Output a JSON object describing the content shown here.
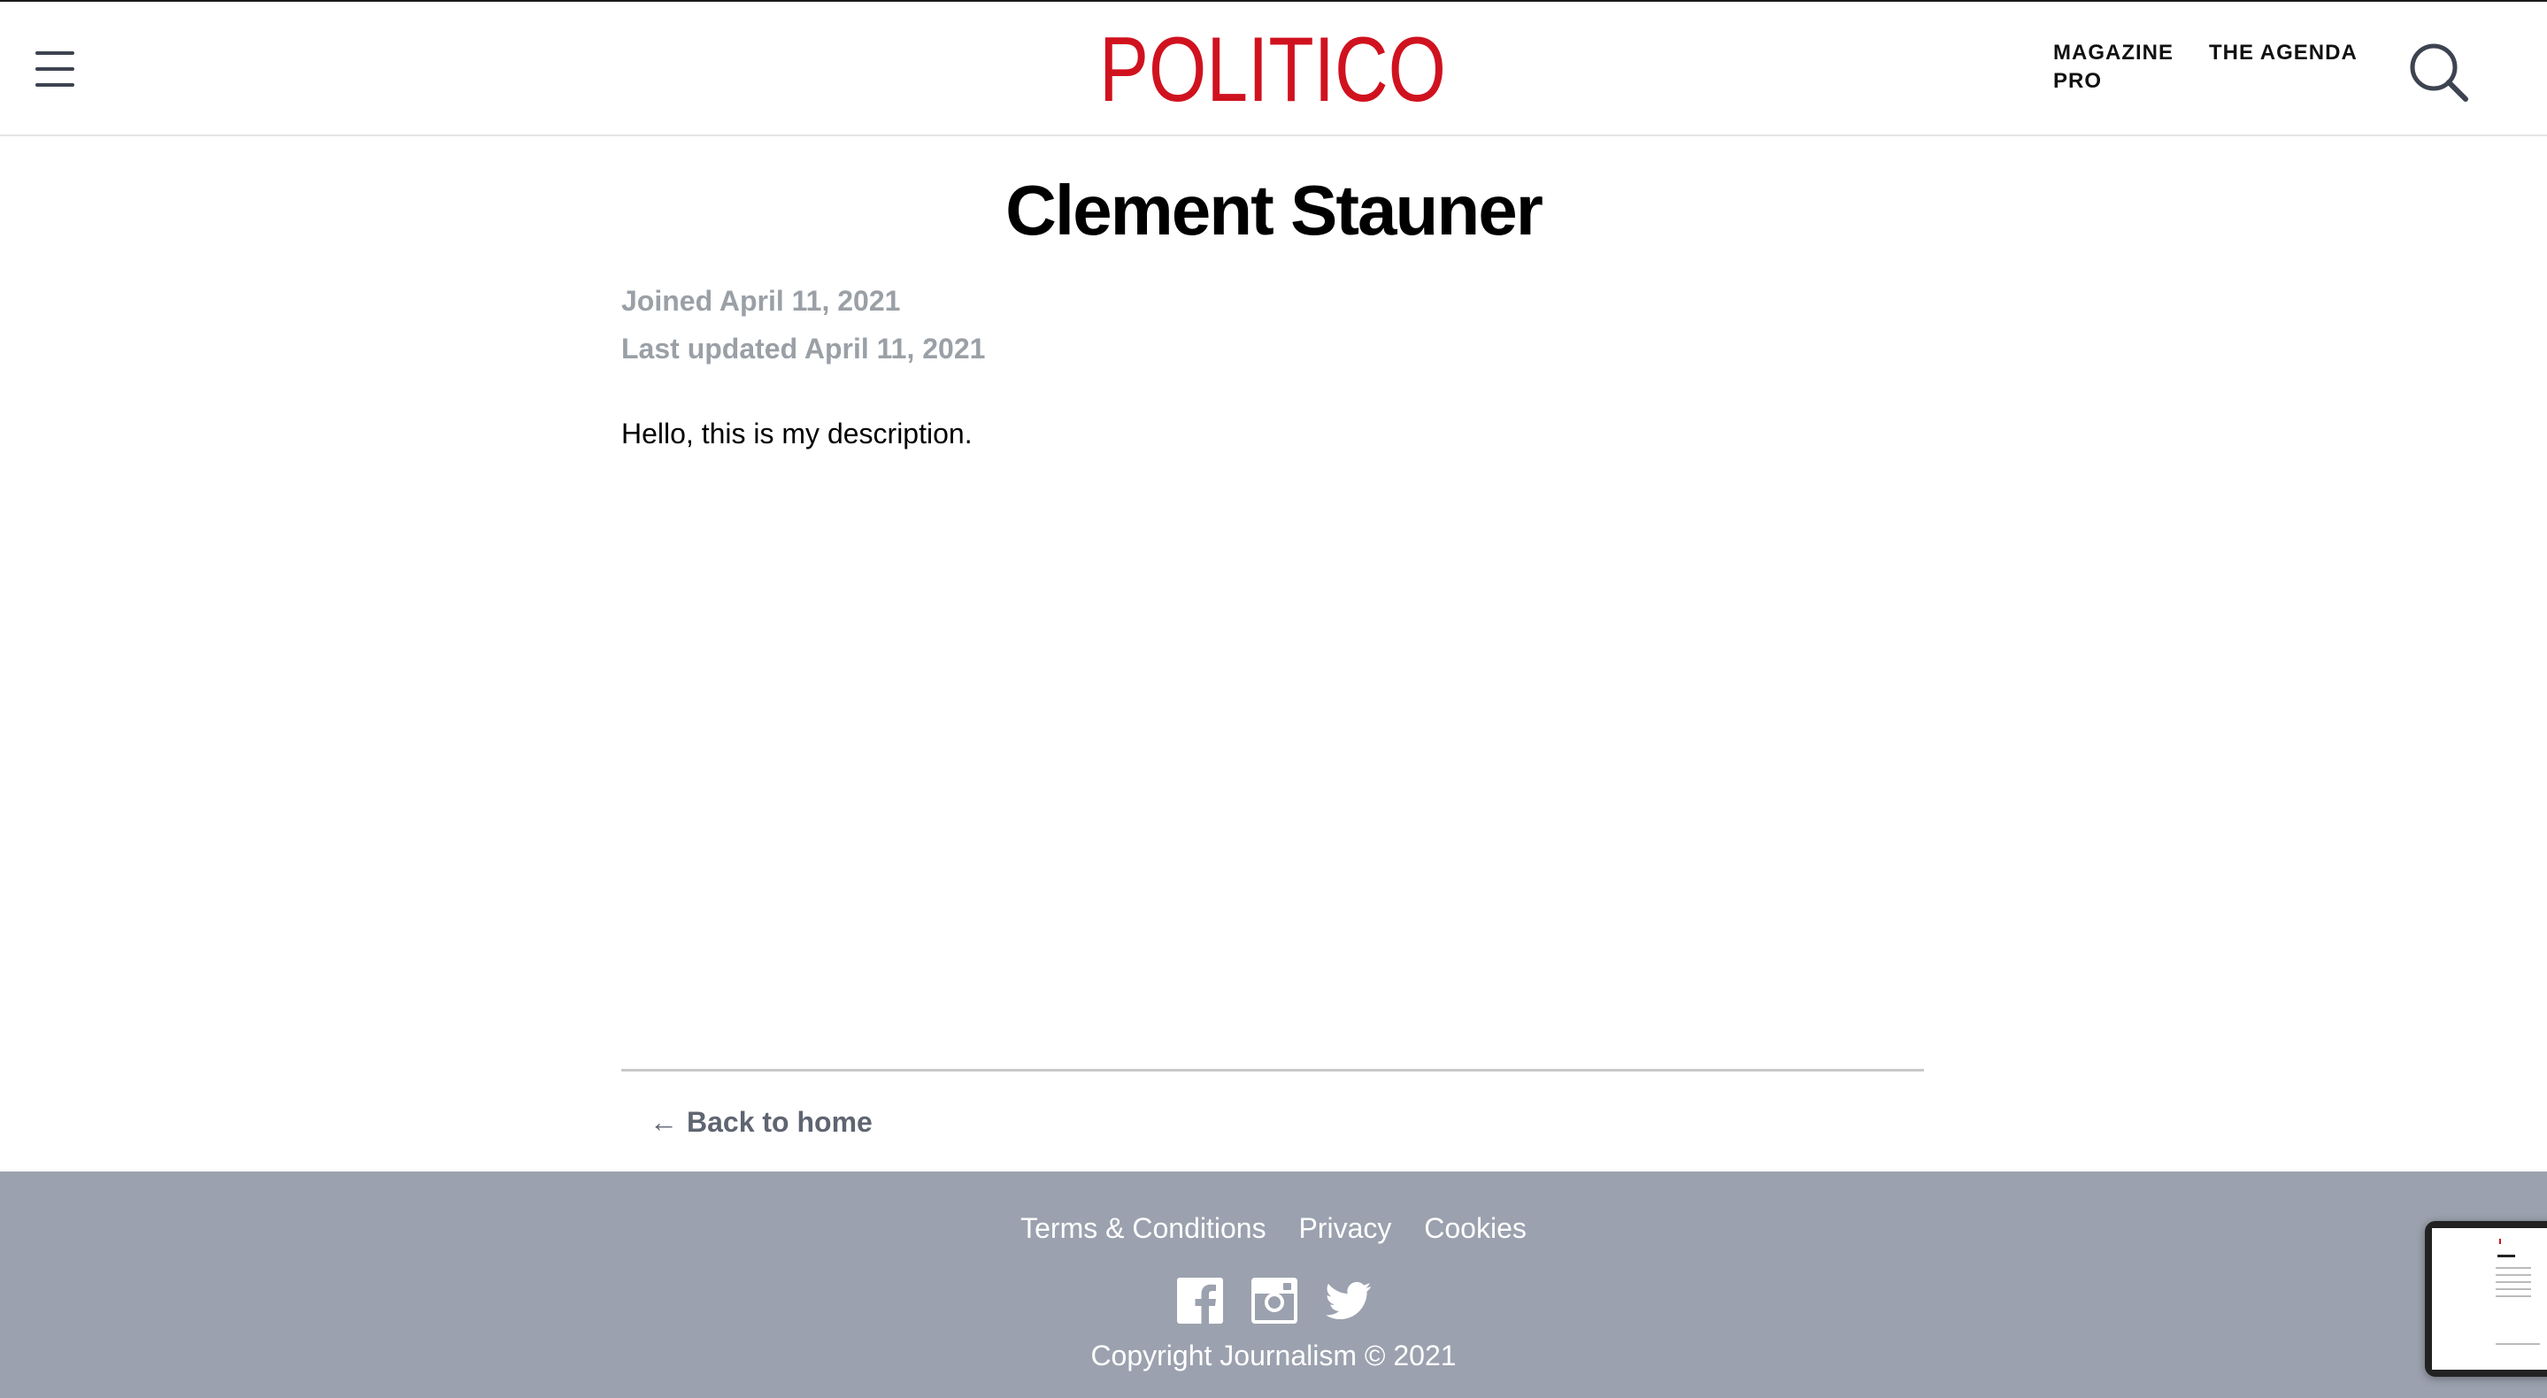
{
  "header": {
    "logo_text": "POLITICO",
    "nav": [
      {
        "label": "MAGAZINE"
      },
      {
        "label": "PRO"
      },
      {
        "label": "THE AGENDA"
      }
    ],
    "menu_icon": "hamburger-menu-icon",
    "search_icon": "search-icon"
  },
  "profile": {
    "name": "Clement Stauner",
    "joined": "Joined April 11, 2021",
    "last_updated": "Last updated April 11, 2021",
    "description": "Hello, this is my description."
  },
  "back_link": {
    "arrow": "←",
    "label": "Back to home"
  },
  "footer": {
    "links": [
      {
        "label": "Terms & Conditions"
      },
      {
        "label": "Privacy"
      },
      {
        "label": "Cookies"
      }
    ],
    "social_icons": [
      "facebook-icon",
      "instagram-icon",
      "twitter-icon"
    ],
    "copyright": "Copyright Journalism © 2021"
  },
  "colors": {
    "brand_red": "#d0121f",
    "footer_bg": "#9ba1ae",
    "meta_gray": "#9aa0a6",
    "link_gray": "#5f6571"
  }
}
